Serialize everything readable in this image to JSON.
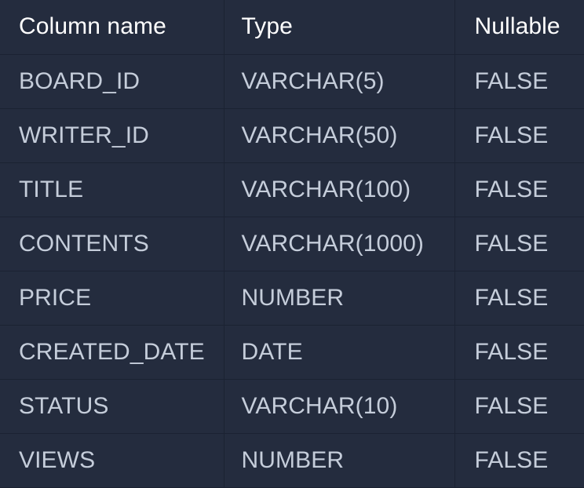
{
  "table": {
    "headers": {
      "column_name": "Column name",
      "type": "Type",
      "nullable": "Nullable"
    },
    "rows": [
      {
        "name": "BOARD_ID",
        "type": "VARCHAR(5)",
        "nullable": "FALSE"
      },
      {
        "name": "WRITER_ID",
        "type": "VARCHAR(50)",
        "nullable": "FALSE"
      },
      {
        "name": "TITLE",
        "type": "VARCHAR(100)",
        "nullable": "FALSE"
      },
      {
        "name": "CONTENTS",
        "type": "VARCHAR(1000)",
        "nullable": "FALSE"
      },
      {
        "name": "PRICE",
        "type": "NUMBER",
        "nullable": "FALSE"
      },
      {
        "name": "CREATED_DATE",
        "type": "DATE",
        "nullable": "FALSE"
      },
      {
        "name": "STATUS",
        "type": "VARCHAR(10)",
        "nullable": "FALSE"
      },
      {
        "name": "VIEWS",
        "type": "NUMBER",
        "nullable": "FALSE"
      }
    ]
  },
  "colors": {
    "background": "#242c3e",
    "border": "#1b2232",
    "header_text": "#ffffff",
    "body_text": "#c5cdda"
  }
}
